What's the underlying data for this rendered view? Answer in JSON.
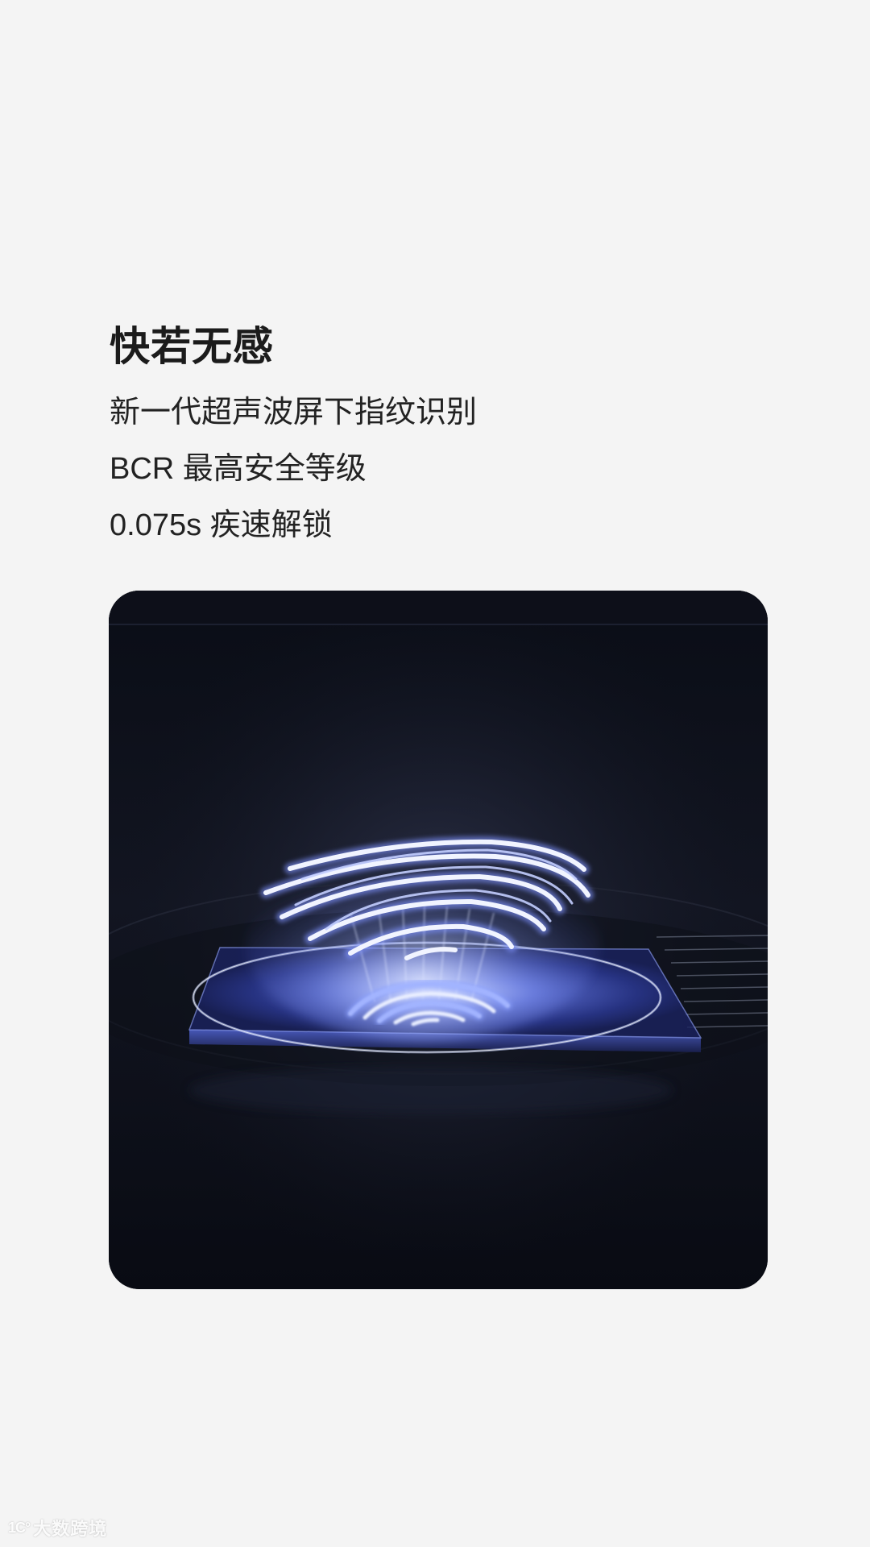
{
  "headline": "快若无感",
  "features": [
    "新一代超声波屏下指纹识别",
    "BCR 最高安全等级",
    "0.075s 疾速解锁"
  ],
  "image": {
    "subject": "fingerprint-sensor-illustration",
    "accent_color": "#6f8dff",
    "glow_color": "#c9d6ff",
    "background_color": "#0b0e17"
  },
  "watermark": {
    "logo": "1С°",
    "text": "大数跨境"
  }
}
